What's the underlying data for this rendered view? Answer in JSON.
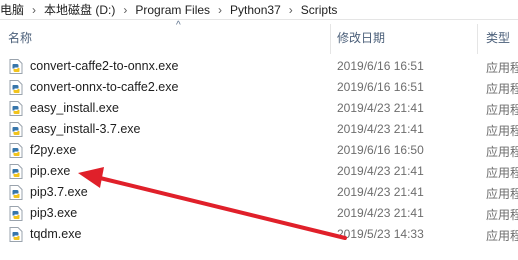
{
  "breadcrumb": [
    "电脑",
    "本地磁盘 (D:)",
    "Program Files",
    "Python37",
    "Scripts"
  ],
  "breadcrumb_separator": "›",
  "columns": {
    "name": "名称",
    "date": "修改日期",
    "type": "类型"
  },
  "sort_indicator": "^",
  "files": [
    {
      "name": "convert-caffe2-to-onnx.exe",
      "date": "2019/6/16 16:51",
      "type": "应用程"
    },
    {
      "name": "convert-onnx-to-caffe2.exe",
      "date": "2019/6/16 16:51",
      "type": "应用程"
    },
    {
      "name": "easy_install.exe",
      "date": "2019/4/23 21:41",
      "type": "应用程"
    },
    {
      "name": "easy_install-3.7.exe",
      "date": "2019/4/23 21:41",
      "type": "应用程"
    },
    {
      "name": "f2py.exe",
      "date": "2019/6/16 16:50",
      "type": "应用程"
    },
    {
      "name": "pip.exe",
      "date": "2019/4/23 21:41",
      "type": "应用程"
    },
    {
      "name": "pip3.7.exe",
      "date": "2019/4/23 21:41",
      "type": "应用程"
    },
    {
      "name": "pip3.exe",
      "date": "2019/4/23 21:41",
      "type": "应用程"
    },
    {
      "name": "tqdm.exe",
      "date": "2019/5/23 14:33",
      "type": "应用程"
    }
  ],
  "icons": {
    "file": "python-exe-icon",
    "annotation": "red-arrow"
  },
  "colors": {
    "header_text": "#4c607a",
    "annotation_arrow": "#e0202a"
  }
}
